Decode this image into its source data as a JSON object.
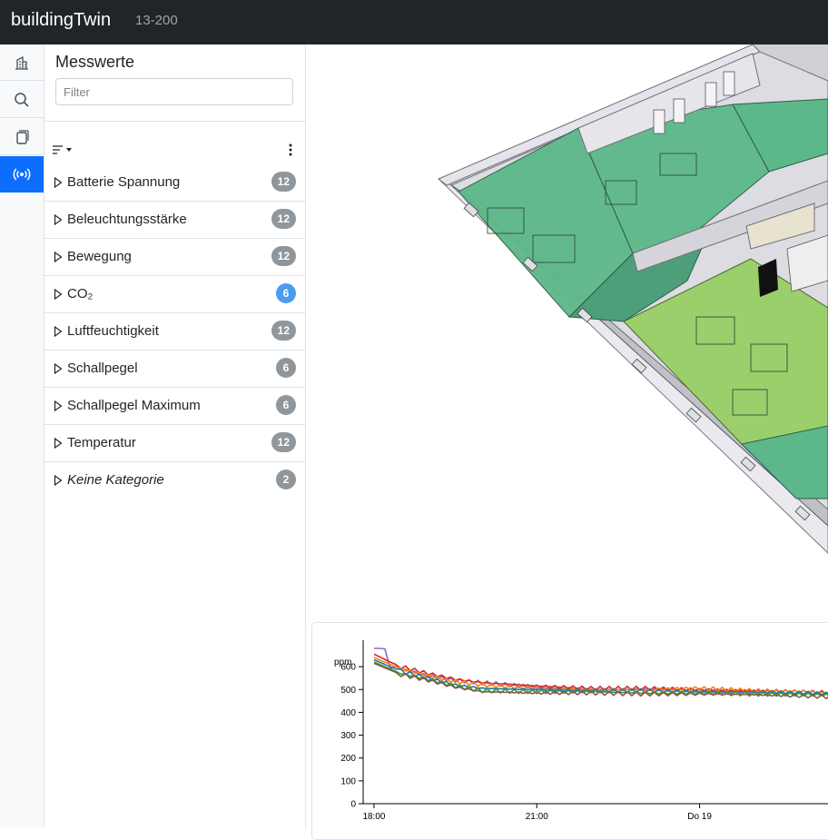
{
  "header": {
    "brand": "buildingTwin",
    "project": "13-200"
  },
  "rail": {
    "items": [
      {
        "icon": "building-icon",
        "active": false
      },
      {
        "icon": "search-icon",
        "active": false
      },
      {
        "icon": "copy-icon",
        "active": false
      },
      {
        "icon": "sensor-broadcast-icon",
        "active": true
      }
    ],
    "active_color": "#0d6efd"
  },
  "panel": {
    "title": "Messwerte",
    "filter_placeholder": "Filter",
    "sort_icon": "sort-lines-icon",
    "menu_icon": "kebab-menu-icon",
    "categories": [
      {
        "label": "Batterie Spannung",
        "count": "12",
        "highlighted": false,
        "italic": false
      },
      {
        "label": "Beleuchtungsstärke",
        "count": "12",
        "highlighted": false,
        "italic": false
      },
      {
        "label": "Bewegung",
        "count": "12",
        "highlighted": false,
        "italic": false
      },
      {
        "label": "CO₂",
        "count": "6",
        "highlighted": true,
        "italic": false
      },
      {
        "label": "Luftfeuchtigkeit",
        "count": "12",
        "highlighted": false,
        "italic": false
      },
      {
        "label": "Schallpegel",
        "count": "6",
        "highlighted": false,
        "italic": false
      },
      {
        "label": "Schallpegel Maximum",
        "count": "6",
        "highlighted": false,
        "italic": false
      },
      {
        "label": "Temperatur",
        "count": "12",
        "highlighted": false,
        "italic": false
      },
      {
        "label": "Keine Kategorie",
        "count": "2",
        "highlighted": false,
        "italic": true
      }
    ]
  },
  "viewer": {
    "content": "3d-floor-model",
    "colors": {
      "green": "#5cb88a",
      "light_green": "#9bcf6b",
      "wall": "#d8d8dc"
    }
  },
  "chart_data": {
    "type": "line",
    "ylabel": "ppm",
    "yticks": [
      0,
      100,
      200,
      300,
      400,
      500,
      600
    ],
    "ylim": [
      0,
      700
    ],
    "xticks": [
      "18:00",
      "21:00",
      "Do 19"
    ],
    "x_hours_range": [
      -0.2,
      8.5
    ],
    "series": [
      {
        "color": "#9467bd",
        "values": [
          [
            0,
            680
          ],
          [
            0.1,
            680
          ],
          [
            0.2,
            670
          ],
          [
            0.3,
            600
          ],
          [
            0.5,
            590
          ],
          [
            1,
            560
          ],
          [
            1.5,
            540
          ],
          [
            2,
            530
          ],
          [
            3,
            510
          ],
          [
            4,
            500
          ],
          [
            5,
            500
          ],
          [
            6,
            495
          ],
          [
            7,
            490
          ],
          [
            8,
            485
          ],
          [
            8.5,
            480
          ]
        ]
      },
      {
        "color": "#d62728",
        "values": [
          [
            0,
            655
          ],
          [
            0.3,
            620
          ],
          [
            0.5,
            600
          ],
          [
            1,
            570
          ],
          [
            1.5,
            545
          ],
          [
            2,
            530
          ],
          [
            3,
            515
          ],
          [
            4,
            505
          ],
          [
            5,
            505
          ],
          [
            6,
            500
          ],
          [
            7,
            495
          ],
          [
            8,
            490
          ],
          [
            8.5,
            485
          ]
        ]
      },
      {
        "color": "#ff7f0e",
        "values": [
          [
            0,
            640
          ],
          [
            0.3,
            610
          ],
          [
            0.5,
            590
          ],
          [
            1,
            560
          ],
          [
            1.5,
            535
          ],
          [
            2,
            520
          ],
          [
            3,
            505
          ],
          [
            4,
            500
          ],
          [
            5,
            500
          ],
          [
            6,
            505
          ],
          [
            7,
            495
          ],
          [
            8,
            490
          ],
          [
            8.5,
            480
          ]
        ]
      },
      {
        "color": "#1f77b4",
        "values": [
          [
            0,
            630
          ],
          [
            0.3,
            600
          ],
          [
            0.5,
            580
          ],
          [
            1,
            550
          ],
          [
            1.5,
            520
          ],
          [
            2,
            505
          ],
          [
            3,
            500
          ],
          [
            4,
            495
          ],
          [
            5,
            495
          ],
          [
            6,
            490
          ],
          [
            7,
            490
          ],
          [
            8,
            485
          ],
          [
            8.5,
            478
          ]
        ]
      },
      {
        "color": "#2ca02c",
        "values": [
          [
            0,
            620
          ],
          [
            0.3,
            590
          ],
          [
            0.5,
            570
          ],
          [
            1,
            545
          ],
          [
            1.5,
            515
          ],
          [
            2,
            495
          ],
          [
            3,
            490
          ],
          [
            4,
            490
          ],
          [
            5,
            485
          ],
          [
            6,
            485
          ],
          [
            7,
            480
          ],
          [
            8,
            478
          ],
          [
            8.5,
            475
          ]
        ]
      },
      {
        "color": "#8c564b",
        "values": [
          [
            0,
            615
          ],
          [
            0.3,
            585
          ],
          [
            0.5,
            565
          ],
          [
            1,
            540
          ],
          [
            1.5,
            510
          ],
          [
            2,
            490
          ],
          [
            3,
            485
          ],
          [
            4,
            485
          ],
          [
            5,
            480
          ],
          [
            6,
            480
          ],
          [
            7,
            478
          ],
          [
            8,
            470
          ],
          [
            8.5,
            468
          ]
        ]
      }
    ]
  }
}
